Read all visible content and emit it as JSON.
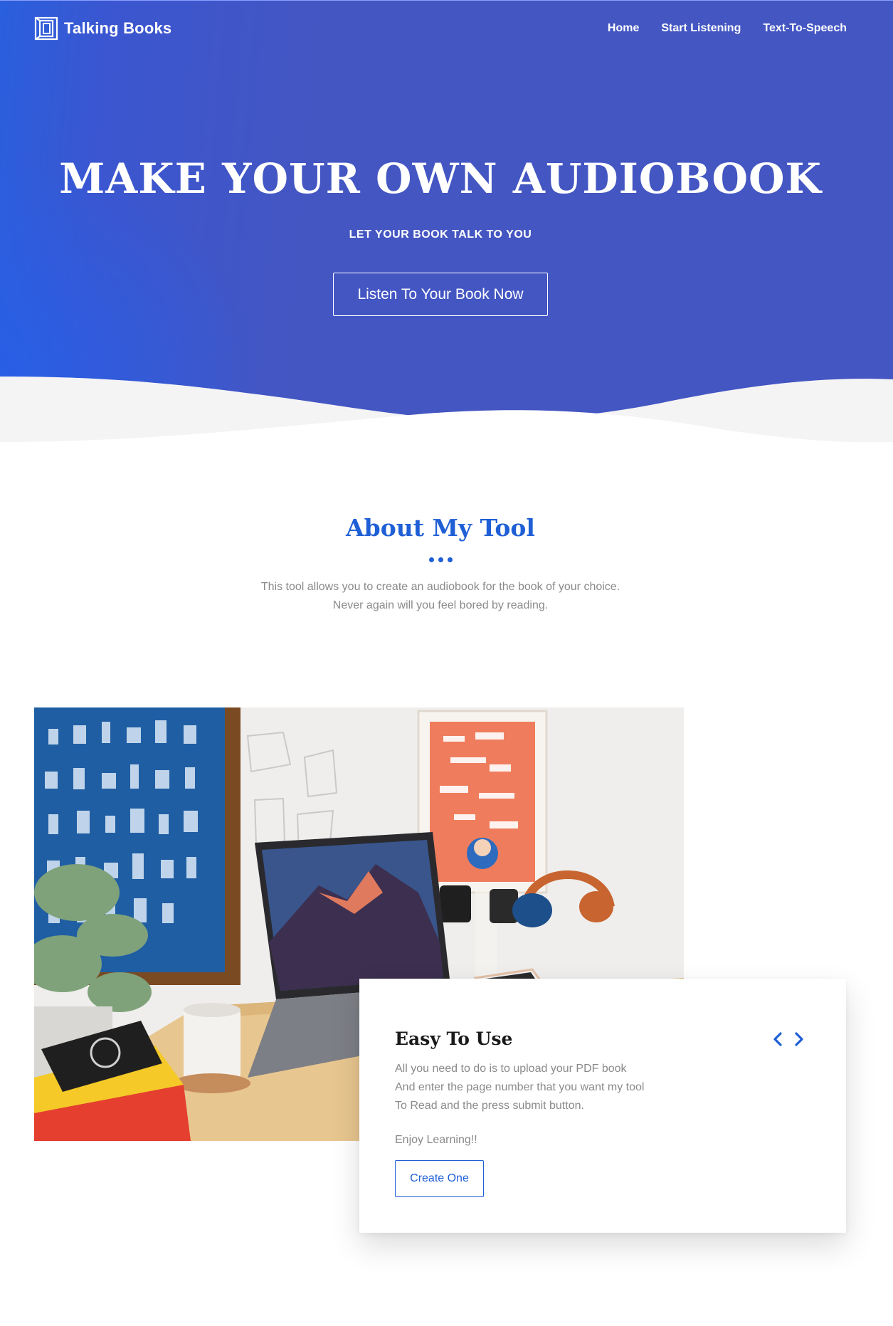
{
  "brand": {
    "name": "Talking Books",
    "icon": "book-logo-icon"
  },
  "nav": {
    "items": [
      "Home",
      "Start Listening",
      "Text-To-Speech"
    ]
  },
  "hero": {
    "title": "MAKE YOUR OWN AUDIOBOOK",
    "subtitle": "LET YOUR BOOK TALK TO YOU",
    "cta_label": "Listen To Your Book Now"
  },
  "about": {
    "title": "About My Tool",
    "lines": [
      "This tool allows you to create an audiobook for the book of your choice.",
      "Never again will you feel bored by reading."
    ]
  },
  "feature_card": {
    "title": "Easy To Use",
    "lines": [
      "All you need to do is to upload your PDF book",
      "And enter the page number that you want my tool",
      "To Read and the press submit button."
    ],
    "note": "Enjoy Learning!!",
    "button_label": "Create One",
    "prev_icon": "chevron-left-icon",
    "next_icon": "chevron-right-icon"
  },
  "colors": {
    "hero_bg": "#4456c2",
    "hero_accent": "#2a5fde",
    "accent": "#1f5fd6",
    "muted_text": "#8a8a8a",
    "wave_light": "#f4f4f5"
  }
}
